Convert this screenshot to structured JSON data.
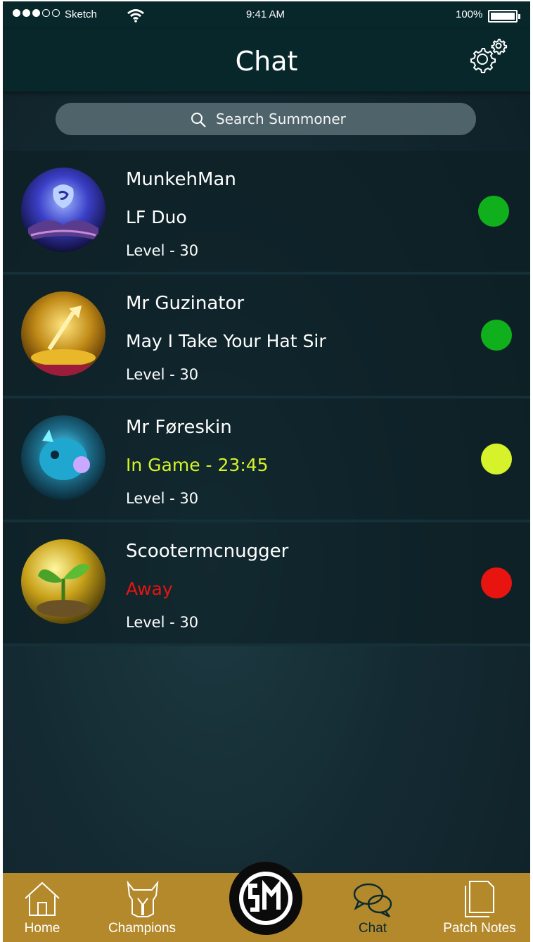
{
  "status_bar": {
    "carrier": "Sketch",
    "time": "9:41 AM",
    "battery": "100%"
  },
  "header": {
    "title": "Chat",
    "settings_icon": "gear-icon"
  },
  "search": {
    "placeholder": "Search Summoner",
    "icon": "search-icon"
  },
  "summoners": [
    {
      "name": "MunkehMan",
      "status": "LF Duo",
      "level": "Level - 30",
      "presence_color": "#10b01c",
      "status_color": "#ffffff"
    },
    {
      "name": "Mr Guzinator",
      "status": "May I Take Your Hat Sir",
      "level": "Level - 30",
      "presence_color": "#10b01c",
      "status_color": "#ffffff"
    },
    {
      "name": "Mr Føreskin",
      "status": "In Game - 23:45",
      "level": "Level - 30",
      "presence_color": "#d6f22a",
      "status_color": "#d6f22a"
    },
    {
      "name": "Scootermcnugger",
      "status": "Away",
      "level": "Level - 30",
      "presence_color": "#e8140f",
      "status_color": "#e8140f"
    }
  ],
  "tab_bar": {
    "tabs": [
      {
        "label": "Home",
        "icon": "home-icon"
      },
      {
        "label": "Champions",
        "icon": "helmet-icon"
      },
      {
        "label": "Chat",
        "icon": "chat-bubbles-icon",
        "active": true
      },
      {
        "label": "Patch Notes",
        "icon": "document-icon"
      }
    ],
    "center_logo": "team-logo-icon"
  },
  "colors": {
    "navbar": "#08272a",
    "tab_bar": "#b4892c",
    "online": "#10b01c",
    "in_game": "#d6f22a",
    "away": "#e8140f"
  }
}
